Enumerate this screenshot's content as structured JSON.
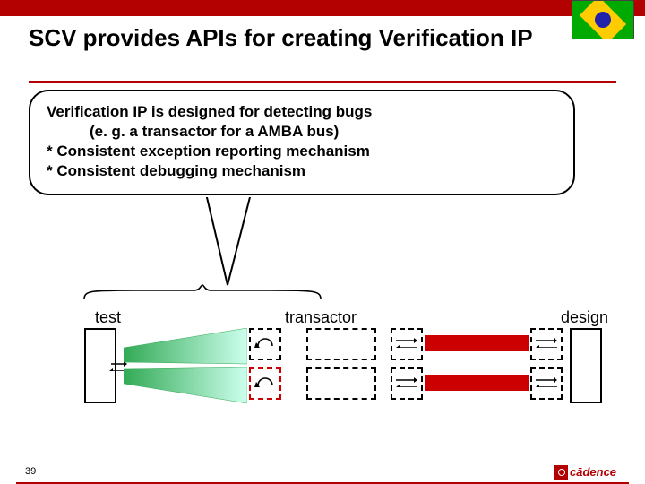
{
  "title": "SCV provides APIs for creating Verification IP",
  "callout": {
    "line1": "Verification IP is designed for detecting bugs",
    "line2": "(e. g. a transactor for a AMBA bus)",
    "line3": "* Consistent exception reporting mechanism",
    "line4": "* Consistent debugging mechanism"
  },
  "labels": {
    "test": "test",
    "transactor": "transactor",
    "design": "design"
  },
  "footer": {
    "page": "39",
    "brand": "cādence"
  },
  "colors": {
    "accent": "#b30000",
    "fanFill": "#77b255",
    "barFill": "#c00"
  }
}
